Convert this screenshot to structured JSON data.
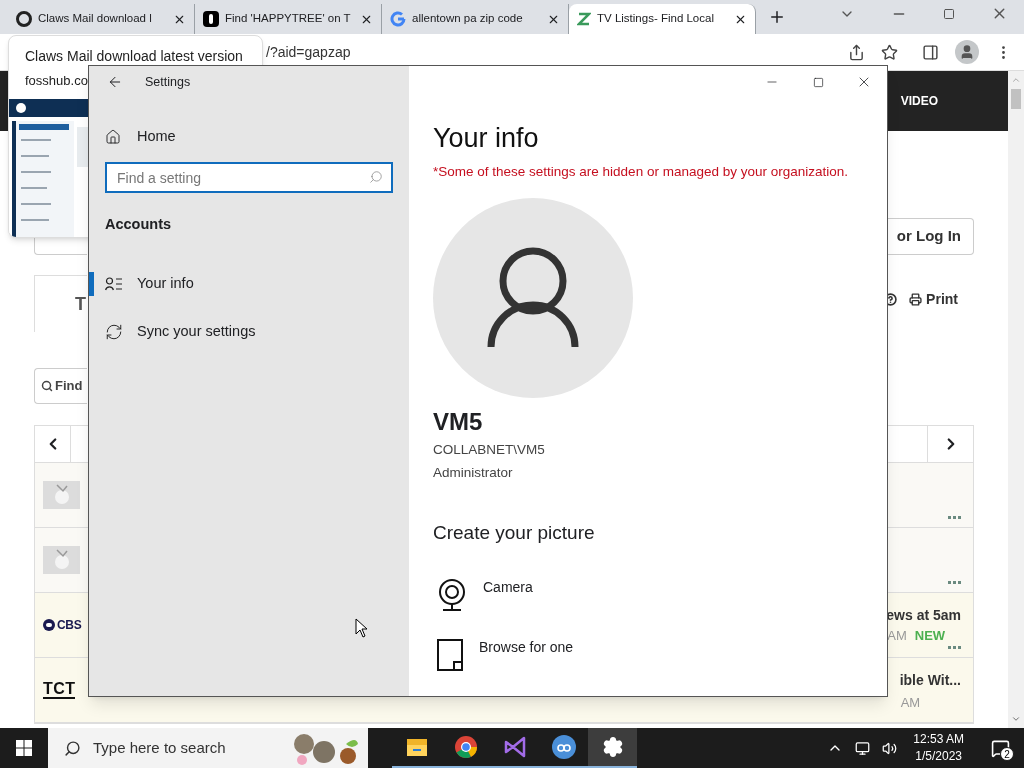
{
  "browser": {
    "tabs": [
      {
        "title": "Claws Mail download l",
        "selected": false
      },
      {
        "title": "Find 'HAPPYTREE' on T",
        "selected": false
      },
      {
        "title": "allentown pa zip code",
        "selected": false
      },
      {
        "title": "TV Listings- Find Local",
        "selected": true
      }
    ],
    "address": "/?aid=gapzap"
  },
  "tab_preview": {
    "title": "Claws Mail download latest version",
    "site": "fosshub.co"
  },
  "page": {
    "header_link": "VIDEO",
    "login_button": "or Log In",
    "print_link": "Print",
    "title_initial": "T",
    "search_label": "Find",
    "rows": [
      {
        "kind": "thumb"
      },
      {
        "kind": "thumb"
      },
      {
        "kind": "wordmark",
        "logo": "CBS",
        "show": "ews at 5am",
        "time": "AM",
        "badge": "NEW"
      },
      {
        "kind": "underlined",
        "logo": "TCT",
        "show": "ible Wit...",
        "time": "AM"
      }
    ]
  },
  "settings": {
    "title": "Settings",
    "home": "Home",
    "search": {
      "placeholder": "Find a setting"
    },
    "section": "Accounts",
    "items": [
      {
        "label": "Your info",
        "selected": true
      },
      {
        "label": "Sync your settings",
        "selected": false
      }
    ],
    "heading": "Your info",
    "notice": "*Some of these settings are hidden or managed by your organization.",
    "user": {
      "name": "VM5",
      "account": "COLLABNET\\VM5",
      "role": "Administrator"
    },
    "picture_heading": "Create your picture",
    "picture_options": [
      {
        "label": "Camera"
      },
      {
        "label": "Browse for one"
      }
    ]
  },
  "taskbar": {
    "search": {
      "placeholder": "Type here to search"
    },
    "apps": [
      {
        "running": true,
        "selected": false
      },
      {
        "running": true,
        "selected": false
      },
      {
        "running": true,
        "selected": false
      },
      {
        "running": true,
        "selected": false
      },
      {
        "running": true,
        "selected": true
      }
    ],
    "time": "12:53 AM",
    "date": "1/5/2023",
    "notifications": "2"
  }
}
